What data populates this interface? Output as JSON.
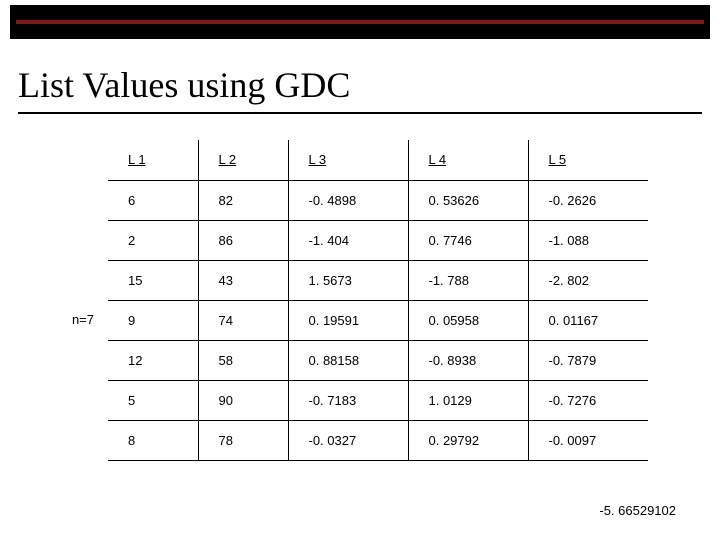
{
  "title": "List Values using GDC",
  "row_label": "n=7",
  "row_label_index": 3,
  "footer_value": "-5. 66529102",
  "chart_data": {
    "type": "table",
    "headers": [
      "L 1",
      "L 2",
      "L 3",
      "L 4",
      "L 5"
    ],
    "rows": [
      [
        "6",
        "82",
        "-0. 4898",
        "0. 53626",
        "-0. 2626"
      ],
      [
        "2",
        "86",
        "-1. 404",
        "0. 7746",
        "-1. 088"
      ],
      [
        "15",
        "43",
        "1. 5673",
        "-1. 788",
        "-2. 802"
      ],
      [
        "9",
        "74",
        "0. 19591",
        "0. 05958",
        "0. 01167"
      ],
      [
        "12",
        "58",
        "0. 88158",
        "-0. 8938",
        "-0. 7879"
      ],
      [
        "5",
        "90",
        "-0. 7183",
        "1. 0129",
        "-0. 7276"
      ],
      [
        "8",
        "78",
        "-0. 0327",
        "0. 29792",
        "-0. 0097"
      ]
    ]
  }
}
